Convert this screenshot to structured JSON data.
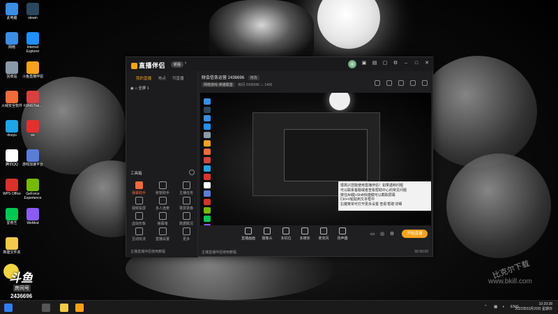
{
  "colors": {
    "accent": "#f6a21b",
    "hot_tool": "#f26b3a",
    "panel": "#1f1f22"
  },
  "desktop_icons": [
    {
      "label": "此电脑",
      "icon": "computer-icon",
      "color": "#3a8ee6"
    },
    {
      "label": "steam",
      "icon": "steam-icon",
      "color": "#2a475e"
    },
    {
      "label": "网络",
      "icon": "network-icon",
      "color": "#3a8ee6"
    },
    {
      "label": "Internet Explorer",
      "icon": "ie-icon",
      "color": "#1e90ff"
    },
    {
      "label": "回收站",
      "icon": "recycle-bin-icon",
      "color": "#8899aa"
    },
    {
      "label": "斗鱼直播伴侣",
      "icon": "douyu-assistant-icon",
      "color": "#f6a21b"
    },
    {
      "label": "火绒安全软件",
      "icon": "huorong-icon",
      "color": "#f26b3a"
    },
    {
      "label": "FUNGTrai...",
      "icon": "fung-icon",
      "color": "#d94040"
    },
    {
      "label": "douyu",
      "icon": "edge-icon",
      "color": "#1fa4e8"
    },
    {
      "label": "ee",
      "icon": "ee-icon",
      "color": "#e52f2f"
    },
    {
      "label": "腾讯QQ",
      "icon": "qq-icon",
      "color": "#ffffff"
    },
    {
      "label": "游戏加速平台",
      "icon": "accelerator-icon",
      "color": "#5a7dd8"
    },
    {
      "label": "WPS Office",
      "icon": "wps-icon",
      "color": "#d8322a"
    },
    {
      "label": "GeForce Experience",
      "icon": "geforce-icon",
      "color": "#76b900"
    },
    {
      "label": "爱奇艺",
      "icon": "iqiyi-icon",
      "color": "#00c853"
    },
    {
      "label": "WeMod",
      "icon": "wemod-icon",
      "color": "#8a5cf6"
    },
    {
      "label": "新建文件夹",
      "icon": "folder-icon",
      "color": "#f2c94c"
    }
  ],
  "app": {
    "logo": "直播伴侣",
    "version": "新版",
    "tabs": [
      "我的直播",
      "热点",
      "可直播"
    ],
    "scene": "全屏 1",
    "tools_title": "工具箱",
    "tools": [
      {
        "label": "弹幕助手",
        "icon": "danmu-icon"
      },
      {
        "label": "房管助手",
        "icon": "manager-icon"
      },
      {
        "label": "主播任务",
        "icon": "task-icon"
      },
      {
        "label": "视频投屏",
        "icon": "cast-icon"
      },
      {
        "label": "多人连麦",
        "icon": "multi-mic-icon"
      },
      {
        "label": "录屏录像",
        "icon": "record-icon"
      },
      {
        "label": "虚拟形象",
        "icon": "avatar-icon"
      },
      {
        "label": "弹幕墙",
        "icon": "danmu-wall-icon"
      },
      {
        "label": "数据概况",
        "icon": "stats-icon"
      },
      {
        "label": "互动玩法",
        "icon": "game-icon"
      },
      {
        "label": "直播设置",
        "icon": "settings-icon"
      },
      {
        "label": "更多",
        "icon": "more-icon"
      }
    ],
    "left_footer": "主播直播伴侣使用教程",
    "room_title": "财会信条运营 2436696",
    "room_tag": "修改",
    "room_sub": {
      "category": "网络游戏-英雄联盟",
      "label": "房间",
      "room_id": "2436696",
      "heat": "1400"
    },
    "toolbar": [
      {
        "label": "直播画面",
        "icon": "screen-icon"
      },
      {
        "label": "摄像头",
        "icon": "camera-icon"
      },
      {
        "label": "多机位",
        "icon": "multi-cam-icon"
      },
      {
        "label": "多媒体",
        "icon": "media-icon"
      },
      {
        "label": "麦克风",
        "icon": "mic-icon"
      },
      {
        "label": "扬声器",
        "icon": "speaker-icon"
      }
    ],
    "start_button": "开始直播",
    "status_left": "主播直播伴侣使用教程",
    "status_right": "00:00:00",
    "note_lines": [
      "很高兴您能使用直播伴侣！如果遇到问题",
      "可以联系客服或者查看帮助中心的常见问题",
      "按住Alt键+Shift快捷键可以截取屏幕",
      "Ctrl+V粘贴到文本框中",
      "右键菜单可打开更多设置 查看'帮助'详细"
    ]
  },
  "overlay": {
    "brand": "斗鱼",
    "room_label": "房间号",
    "room_number": "2436696"
  },
  "watermark": {
    "line1": "比克尔下载",
    "line2": "www.bkill.com"
  },
  "taskbar": {
    "lang": "ENG",
    "time": "10:29:38",
    "date": "2022年03月20日 星期日"
  }
}
